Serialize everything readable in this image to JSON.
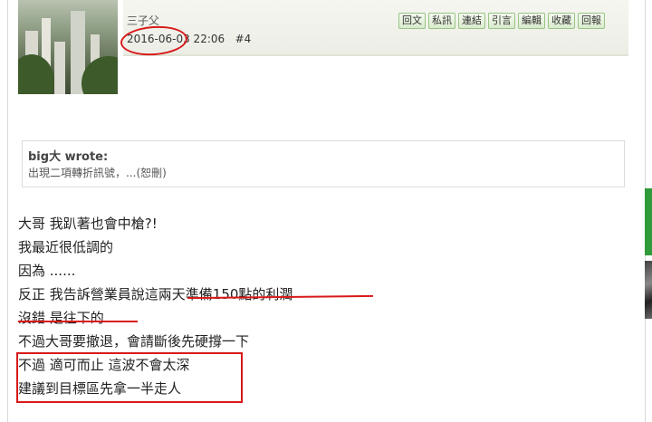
{
  "post": {
    "author": "三子父",
    "timestamp": "2016-06-03 22:06",
    "post_number": "#4",
    "avatar_icon": "avatar-photo-city-skyline"
  },
  "actions": [
    {
      "label": "回文"
    },
    {
      "label": "私訊"
    },
    {
      "label": "連結"
    },
    {
      "label": "引言"
    },
    {
      "label": "編輯"
    },
    {
      "label": "收藏"
    },
    {
      "label": "回報"
    }
  ],
  "quote": {
    "author": "big大 wrote:",
    "text": "出現二項轉折訊號，...(恕刪)"
  },
  "body": {
    "lines": [
      "大哥 我趴著也會中槍?!",
      "我最近很低調的",
      "因為 ......",
      "反正 我告訴營業員說這兩天準備150點的利潤",
      "沒錯 是往下的",
      "不過大哥要撤退，會請斷後先硬撐一下",
      "不過 適可而止 這波不會太深",
      "建議到目標區先拿一半走人"
    ]
  },
  "colors": {
    "annotation_red": "#d81919",
    "button_border": "#9ac485",
    "header_bg": "#f4f6ef",
    "side_accent": "#2e9a3a"
  }
}
